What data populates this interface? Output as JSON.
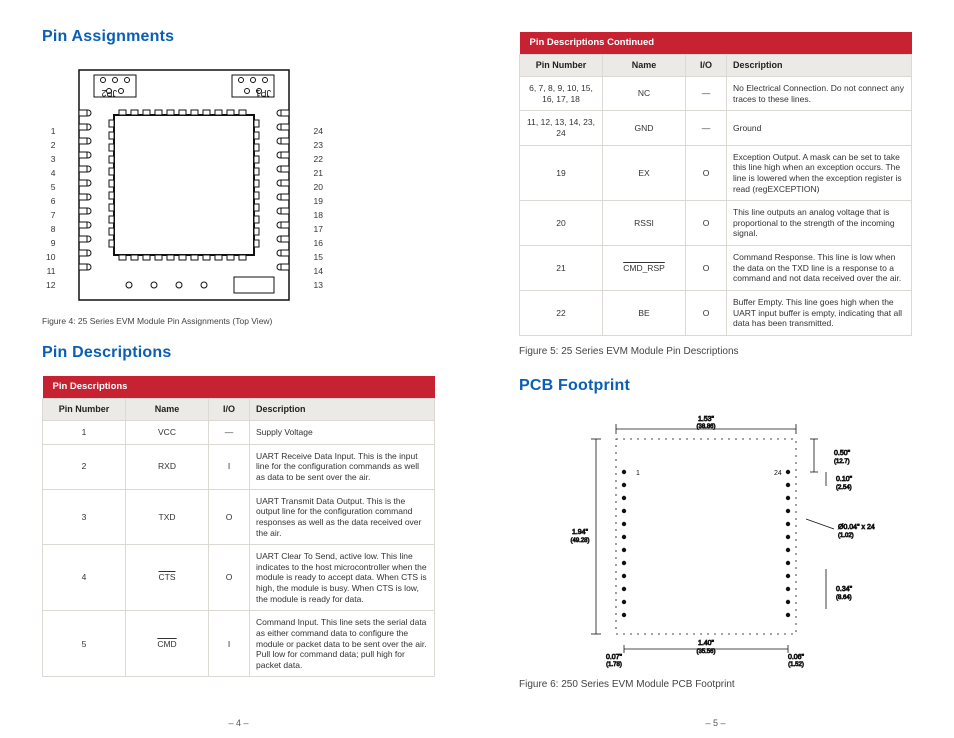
{
  "left": {
    "title_pin_assignments": "Pin Assignments",
    "title_pin_descriptions": "Pin Descriptions",
    "figure4_caption": "Figure 4: 25 Series EVM Module Pin Assignments (Top View)",
    "module": {
      "jp1_label": "JP1",
      "jp2_label": "JP2",
      "left_pins": [
        "1",
        "2",
        "3",
        "4",
        "5",
        "6",
        "7",
        "8",
        "9",
        "10",
        "11",
        "12"
      ],
      "right_pins": [
        "24",
        "23",
        "22",
        "21",
        "20",
        "19",
        "18",
        "17",
        "16",
        "15",
        "14",
        "13"
      ]
    },
    "table": {
      "title": "Pin Descriptions",
      "head": {
        "pin": "Pin Number",
        "name": "Name",
        "io": "I/O",
        "desc": "Description"
      },
      "rows": [
        {
          "pin": "1",
          "name": "VCC",
          "io": "—",
          "desc": "Supply Voltage"
        },
        {
          "pin": "2",
          "name": "RXD",
          "io": "I",
          "desc": "UART Receive Data Input. This is the input line for the configuration commands as well as data to be sent over the air."
        },
        {
          "pin": "3",
          "name": "TXD",
          "io": "O",
          "desc": "UART Transmit Data Output. This is the output line for the configuration command responses as well as the data received over the air."
        },
        {
          "pin": "4",
          "name": "CTS",
          "name_overline": true,
          "io": "O",
          "desc": "UART Clear To Send, active low. This line indicates to the host microcontroller when the module is ready to accept data. When CTS is high, the module is busy. When CTS is low, the module is ready for data.",
          "overline_words": [
            "CTS",
            "CTS"
          ]
        },
        {
          "pin": "5",
          "name": "CMD",
          "name_overline": true,
          "io": "I",
          "desc": "Command Input. This line sets the serial data as either command data to configure the module or packet data to be sent over the air. Pull low for command data; pull high for packet data."
        }
      ]
    },
    "page_number": "– 4 –"
  },
  "right": {
    "table": {
      "title": "Pin Descriptions Continued",
      "head": {
        "pin": "Pin Number",
        "name": "Name",
        "io": "I/O",
        "desc": "Description"
      },
      "rows": [
        {
          "pin": "6, 7, 8, 9, 10, 15, 16, 17, 18",
          "name": "NC",
          "io": "—",
          "desc": "No Electrical Connection. Do not connect any traces to these lines."
        },
        {
          "pin": "11, 12, 13, 14, 23, 24",
          "name": "GND",
          "io": "—",
          "desc": "Ground"
        },
        {
          "pin": "19",
          "name": "EX",
          "io": "O",
          "desc": "Exception Output. A mask can be set to take this line high when an exception occurs. The line is lowered when the exception register is read (regEXCEPTION)"
        },
        {
          "pin": "20",
          "name": "RSSI",
          "io": "O",
          "desc": "This line outputs an analog voltage that is proportional to the strength of the incoming signal."
        },
        {
          "pin": "21",
          "name": "CMD_RSP",
          "name_overline": true,
          "io": "O",
          "desc": "Command Response. This line is low when the data on the TXD line is a response to a command and not data received over the air."
        },
        {
          "pin": "22",
          "name": "BE",
          "io": "O",
          "desc": "Buffer Empty. This line goes high when the UART input buffer is empty, indicating that all data has been transmitted."
        }
      ]
    },
    "figure5_caption": "Figure 5: 25 Series EVM Module Pin Descriptions",
    "title_pcb_footprint": "PCB Footprint",
    "figure6_caption": "Figure 6: 250 Series EVM Module PCB Footprint",
    "footprint": {
      "top_dim": "1.53\"",
      "top_dim_mm": "(38.86)",
      "right_dim1": "0.50\"",
      "right_dim1_mm": "(12.7)",
      "left_dim": "1.94\"",
      "left_dim_mm": "(49.28)",
      "right_dim2": "0.10\"",
      "right_dim2_mm": "(2.54)",
      "bot_dim": "1.40\"",
      "bot_dim_mm": "(35.56)",
      "bl_dim": "0.07\"",
      "bl_dim_mm": "(1.78)",
      "br2_dim": "0.06\"",
      "br2_dim_mm": "(1.52)",
      "pad_dim_a": "Ø0.04\" x 24",
      "pad_dim_a_mm": "(1.02)",
      "r3_dim": "0.34\"",
      "r3_dim_mm": "(8.64)",
      "pin1": "1",
      "pin24": "24"
    },
    "page_number": "– 5 –"
  }
}
